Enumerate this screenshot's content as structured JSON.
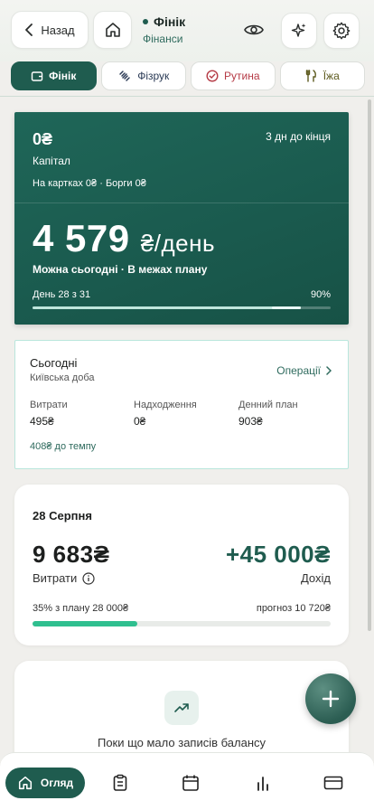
{
  "header": {
    "back_label": "Назад",
    "title": "Фінік",
    "subtitle": "Фінанси"
  },
  "tabs": [
    {
      "label": "Фінік",
      "icon": "wallet-icon",
      "active": true
    },
    {
      "label": "Фізрук",
      "icon": "dumbbell-icon",
      "active": false
    },
    {
      "label": "Рутина",
      "icon": "check-circle-icon",
      "active": false
    },
    {
      "label": "Їжа",
      "icon": "cutlery-icon",
      "active": false
    }
  ],
  "hero": {
    "capital_value": "0₴",
    "capital_label": "Капітал",
    "days_left": "3 дн до кінця",
    "cards_line": "На картках 0₴ · Борги 0₴",
    "daily_amount": "4 579",
    "daily_unit": "₴/день",
    "plan_status": "Можна сьогодні · В межах плану",
    "day_of": "День 28 з 31",
    "percent": "90%",
    "progress": 0.9
  },
  "today": {
    "title": "Сьогодні",
    "subtitle": "Київська доба",
    "operations_link": "Операції",
    "spent_label": "Витрати",
    "spent_value": "495₴",
    "income_label": "Надходження",
    "income_value": "0₴",
    "plan_label": "Денний план",
    "plan_value": "903₴",
    "tempo": "408₴ до темпу"
  },
  "month": {
    "date": "28 Серпня",
    "spent": "9 683₴",
    "spent_label": "Витрати",
    "income": "+45 000₴",
    "income_label": "Дохід",
    "plan_pct": "35% з плану 28 000₴",
    "forecast": "прогноз 10 720₴",
    "progress": 0.35
  },
  "balance": {
    "message": "Поки що мало записів балансу"
  },
  "nav": {
    "active_label": "Огляд",
    "items": [
      "clipboard-icon",
      "calendar-icon",
      "bar-chart-icon",
      "card-icon"
    ]
  },
  "colors": {
    "primary": "#1f5c4f",
    "accent_bar": "#2fbf8f",
    "routine": "#b53a45"
  }
}
